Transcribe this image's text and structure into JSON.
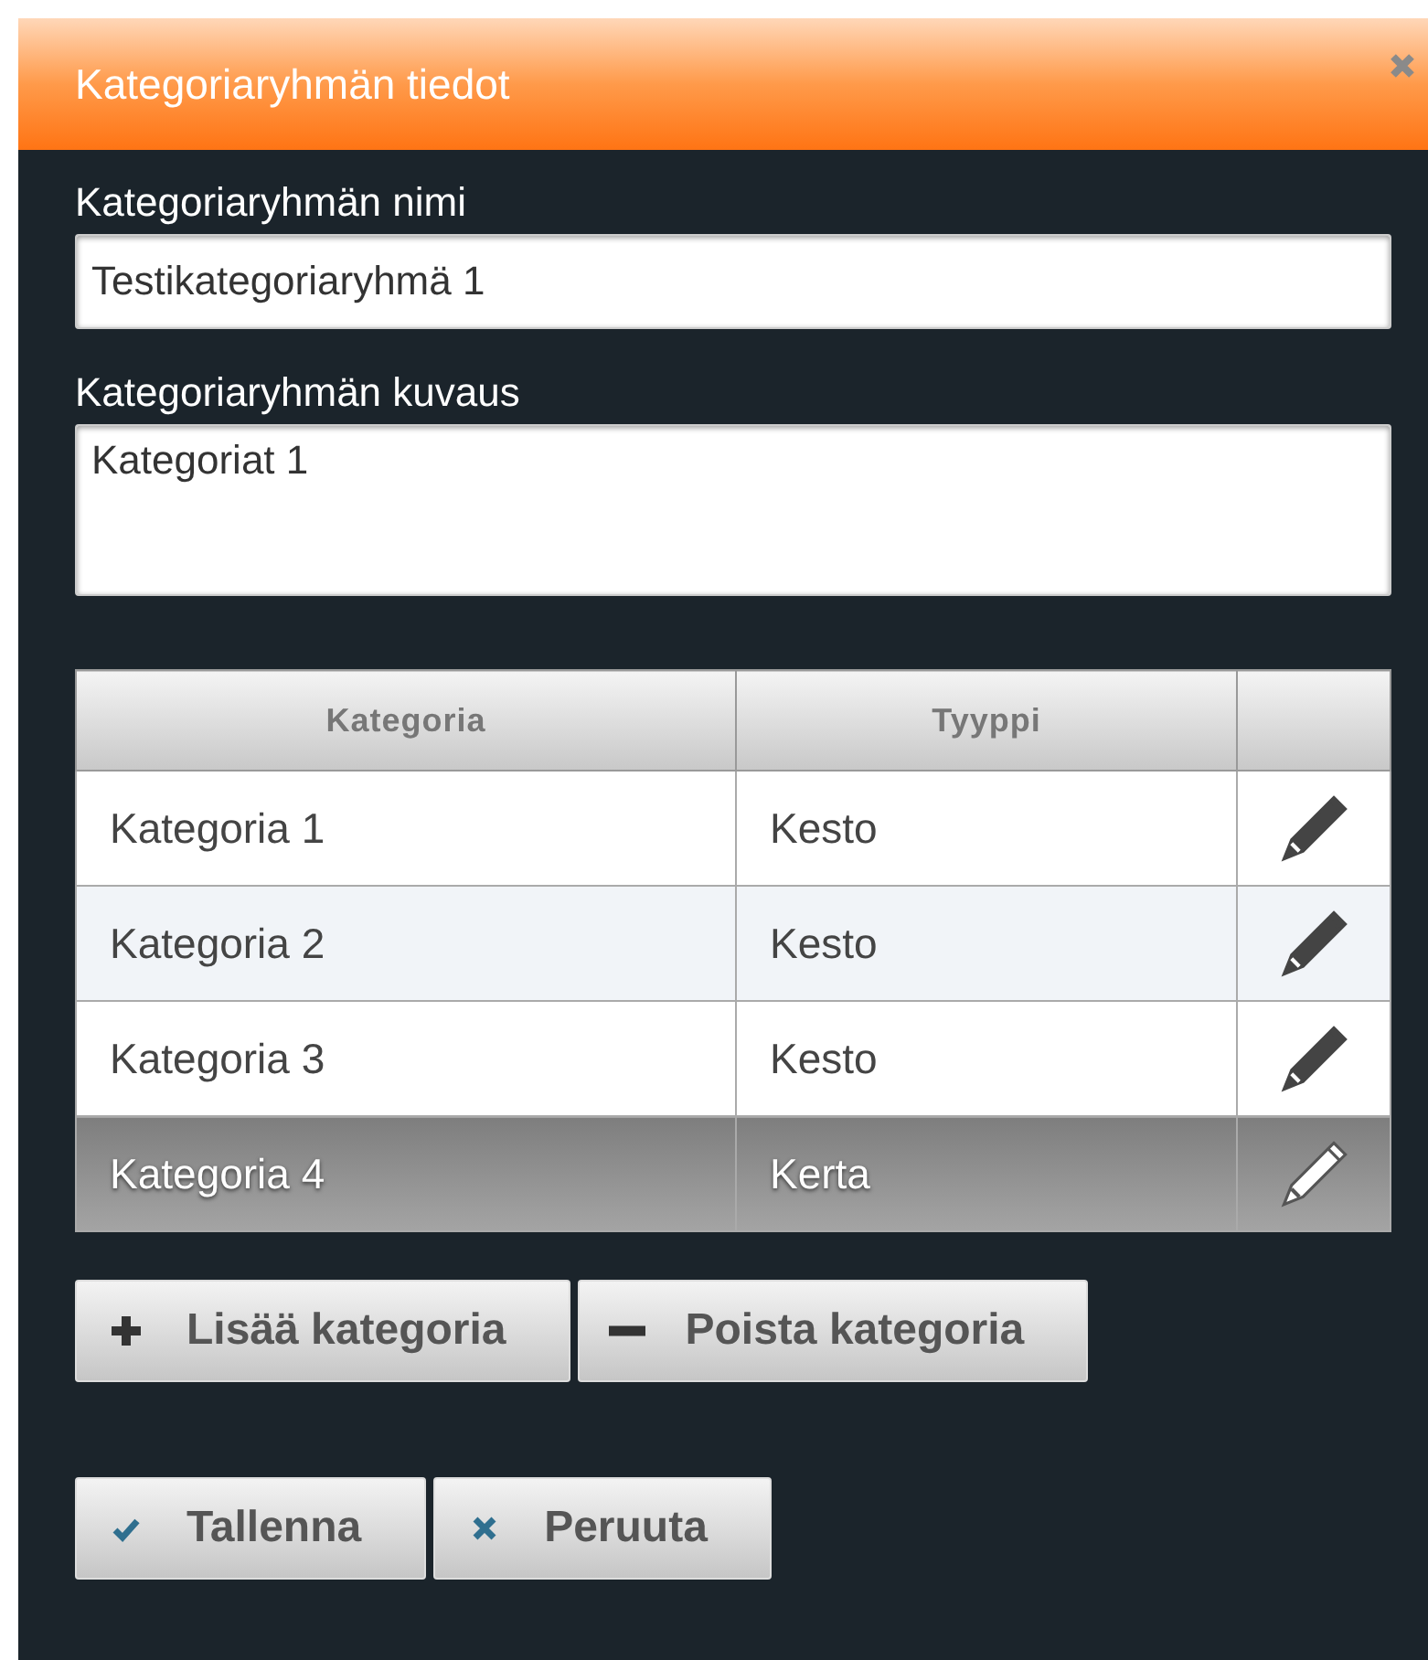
{
  "dialog": {
    "title": "Kategoriaryhmän tiedot"
  },
  "name_field": {
    "label": "Kategoriaryhmän nimi",
    "value": "Testikategoriaryhmä 1"
  },
  "description_field": {
    "label": "Kategoriaryhmän kuvaus",
    "value": "Kategoriat 1"
  },
  "table": {
    "columns": [
      "Kategoria",
      "Tyyppi"
    ],
    "rows": [
      {
        "category": "Kategoria 1",
        "type": "Kesto",
        "selected": false
      },
      {
        "category": "Kategoria 2",
        "type": "Kesto",
        "selected": false
      },
      {
        "category": "Kategoria 3",
        "type": "Kesto",
        "selected": false
      },
      {
        "category": "Kategoria 4",
        "type": "Kerta",
        "selected": true
      }
    ]
  },
  "table_buttons": [
    {
      "label": "Lisää kategoria",
      "kind": "add"
    },
    {
      "label": "Poista kategoria",
      "kind": "remove"
    }
  ],
  "footer_buttons": [
    {
      "label": "Tallenna",
      "kind": "save"
    },
    {
      "label": "Peruuta",
      "kind": "cancel"
    }
  ]
}
